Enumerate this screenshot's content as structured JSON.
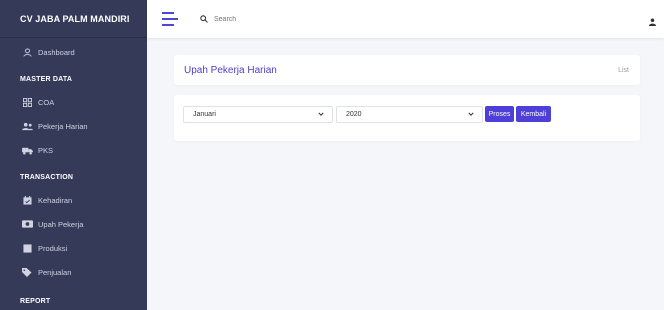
{
  "sidebar": {
    "brand": "CV JABA PALM MANDIRI",
    "dashboard": "Dashboard",
    "sections": [
      {
        "title": "MASTER DATA",
        "items": [
          "COA",
          "Pekerja Harian",
          "PKS"
        ]
      },
      {
        "title": "TRANSACTION",
        "items": [
          "Kehadiran",
          "Upah Pekerja",
          "Produksi",
          "Penjualan"
        ]
      },
      {
        "title": "REPORT",
        "items": []
      }
    ]
  },
  "topbar": {
    "search_placeholder": "Search"
  },
  "page": {
    "title": "Upah Pekerja Harian",
    "breadcrumb": "List"
  },
  "form": {
    "month_value": "Januari",
    "year_value": "2020",
    "process_label": "Proses",
    "back_label": "Kembali"
  },
  "colors": {
    "sidebar_bg": "#343a58",
    "accent": "#4f3fd9",
    "page_bg": "#f5f6fa"
  }
}
